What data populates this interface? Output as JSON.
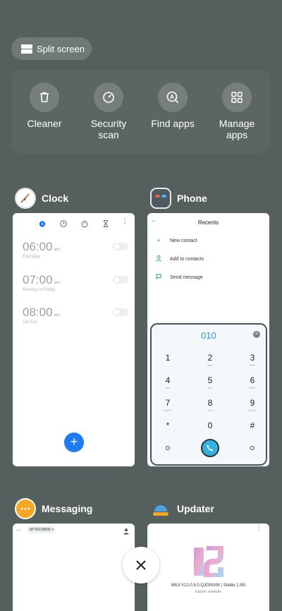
{
  "split_screen": {
    "label": "Split screen"
  },
  "tools": [
    {
      "label": "Cleaner",
      "icon": "trash-icon"
    },
    {
      "label": "Security\nscan",
      "icon": "speedometer-icon"
    },
    {
      "label": "Find apps",
      "icon": "app-search-icon"
    },
    {
      "label": "Manage\napps",
      "icon": "grid-icon"
    }
  ],
  "apps": {
    "clock": {
      "name": "Clock",
      "alarms": [
        {
          "time": "06:00",
          "ampm": "am",
          "days": "Everyday"
        },
        {
          "time": "07:00",
          "ampm": "am",
          "days": "Monday to Friday"
        },
        {
          "time": "08:00",
          "ampm": "am",
          "days": "Sat Sun"
        }
      ],
      "fab": "+"
    },
    "phone": {
      "name": "Phone",
      "title": "Recents",
      "actions": [
        {
          "label": "New contact",
          "icon": "+"
        },
        {
          "label": "Add to contacts",
          "icon": "👤"
        },
        {
          "label": "Send message",
          "icon": "💬"
        }
      ],
      "dial_number": "010",
      "keys": [
        {
          "n": "1",
          "s": ""
        },
        {
          "n": "2",
          "s": "ABC"
        },
        {
          "n": "3",
          "s": "DEF"
        },
        {
          "n": "4",
          "s": "GHI"
        },
        {
          "n": "5",
          "s": "JKL"
        },
        {
          "n": "6",
          "s": "MNO"
        },
        {
          "n": "7",
          "s": "PQRS"
        },
        {
          "n": "8",
          "s": "TUV"
        },
        {
          "n": "9",
          "s": "WXYZ"
        },
        {
          "n": "*",
          "s": ""
        },
        {
          "n": "0",
          "s": "+"
        },
        {
          "n": "#",
          "s": ""
        }
      ]
    },
    "messaging": {
      "name": "Messaging",
      "chip": "18730218809"
    },
    "updater": {
      "name": "Updater",
      "version": "MIUI V12.0.8.0.QJOINXM | Stable 1.9G",
      "status": "Update available"
    }
  },
  "colors": {
    "background": "#55605e",
    "accent_blue": "#1d7cf2",
    "phone_teal": "#32b1e0"
  }
}
